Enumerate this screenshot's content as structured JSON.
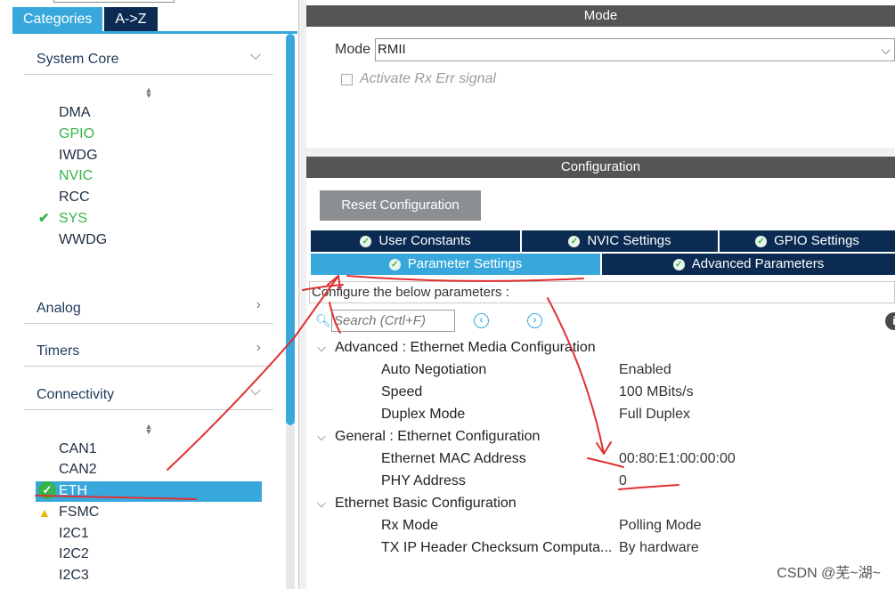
{
  "left_panel": {
    "tabs": [
      {
        "label": "Categories"
      },
      {
        "label": "A->Z"
      }
    ],
    "categories": {
      "system_core": {
        "label": "System Core",
        "items": [
          "DMA",
          "GPIO",
          "IWDG",
          "NVIC",
          "RCC",
          "SYS",
          "WWDG"
        ]
      },
      "analog": {
        "label": "Analog"
      },
      "timers": {
        "label": "Timers"
      },
      "connectivity": {
        "label": "Connectivity",
        "items": [
          "CAN1",
          "CAN2",
          "ETH",
          "FSMC",
          "I2C1",
          "I2C2",
          "I2C3"
        ]
      }
    },
    "icons": {
      "collapsed": "chevron-right",
      "expanded": "chevron-down",
      "ok": "check",
      "warning": "warning-triangle"
    },
    "colors": {
      "accent": "#38a8dc",
      "dark_tab": "#0c2b52",
      "enabled_green": "#36b34a",
      "warning": "#f0b400"
    }
  },
  "mode_section": {
    "header": "Mode",
    "mode_label": "Mode",
    "mode_value": "RMII",
    "rx_err_label": "Activate Rx Err signal"
  },
  "config_section": {
    "header": "Configuration",
    "reset_label": "Reset Configuration",
    "tabs_row1": [
      {
        "label": "User Constants"
      },
      {
        "label": "NVIC Settings"
      },
      {
        "label": "GPIO Settings"
      }
    ],
    "tabs_row2": [
      {
        "label": "Parameter Settings"
      },
      {
        "label": "Advanced Parameters"
      }
    ],
    "prompt": "Configure the below parameters :",
    "search_placeholder": "Search (Crtl+F)",
    "groups": [
      {
        "title": "Advanced : Ethernet Media Configuration",
        "params": [
          {
            "name": "Auto Negotiation",
            "value": "Enabled"
          },
          {
            "name": "Speed",
            "value": "100 MBits/s"
          },
          {
            "name": "Duplex Mode",
            "value": "Full Duplex"
          }
        ]
      },
      {
        "title": "General : Ethernet Configuration",
        "params": [
          {
            "name": "Ethernet MAC Address",
            "value": "00:80:E1:00:00:00"
          },
          {
            "name": "PHY Address",
            "value": "0"
          }
        ]
      },
      {
        "title": "Ethernet Basic Configuration",
        "params": [
          {
            "name": "Rx Mode",
            "value": "Polling Mode"
          },
          {
            "name": "TX IP Header Checksum Computa...",
            "value": "By hardware"
          }
        ]
      }
    ]
  },
  "watermark": "CSDN @芜~湖~"
}
